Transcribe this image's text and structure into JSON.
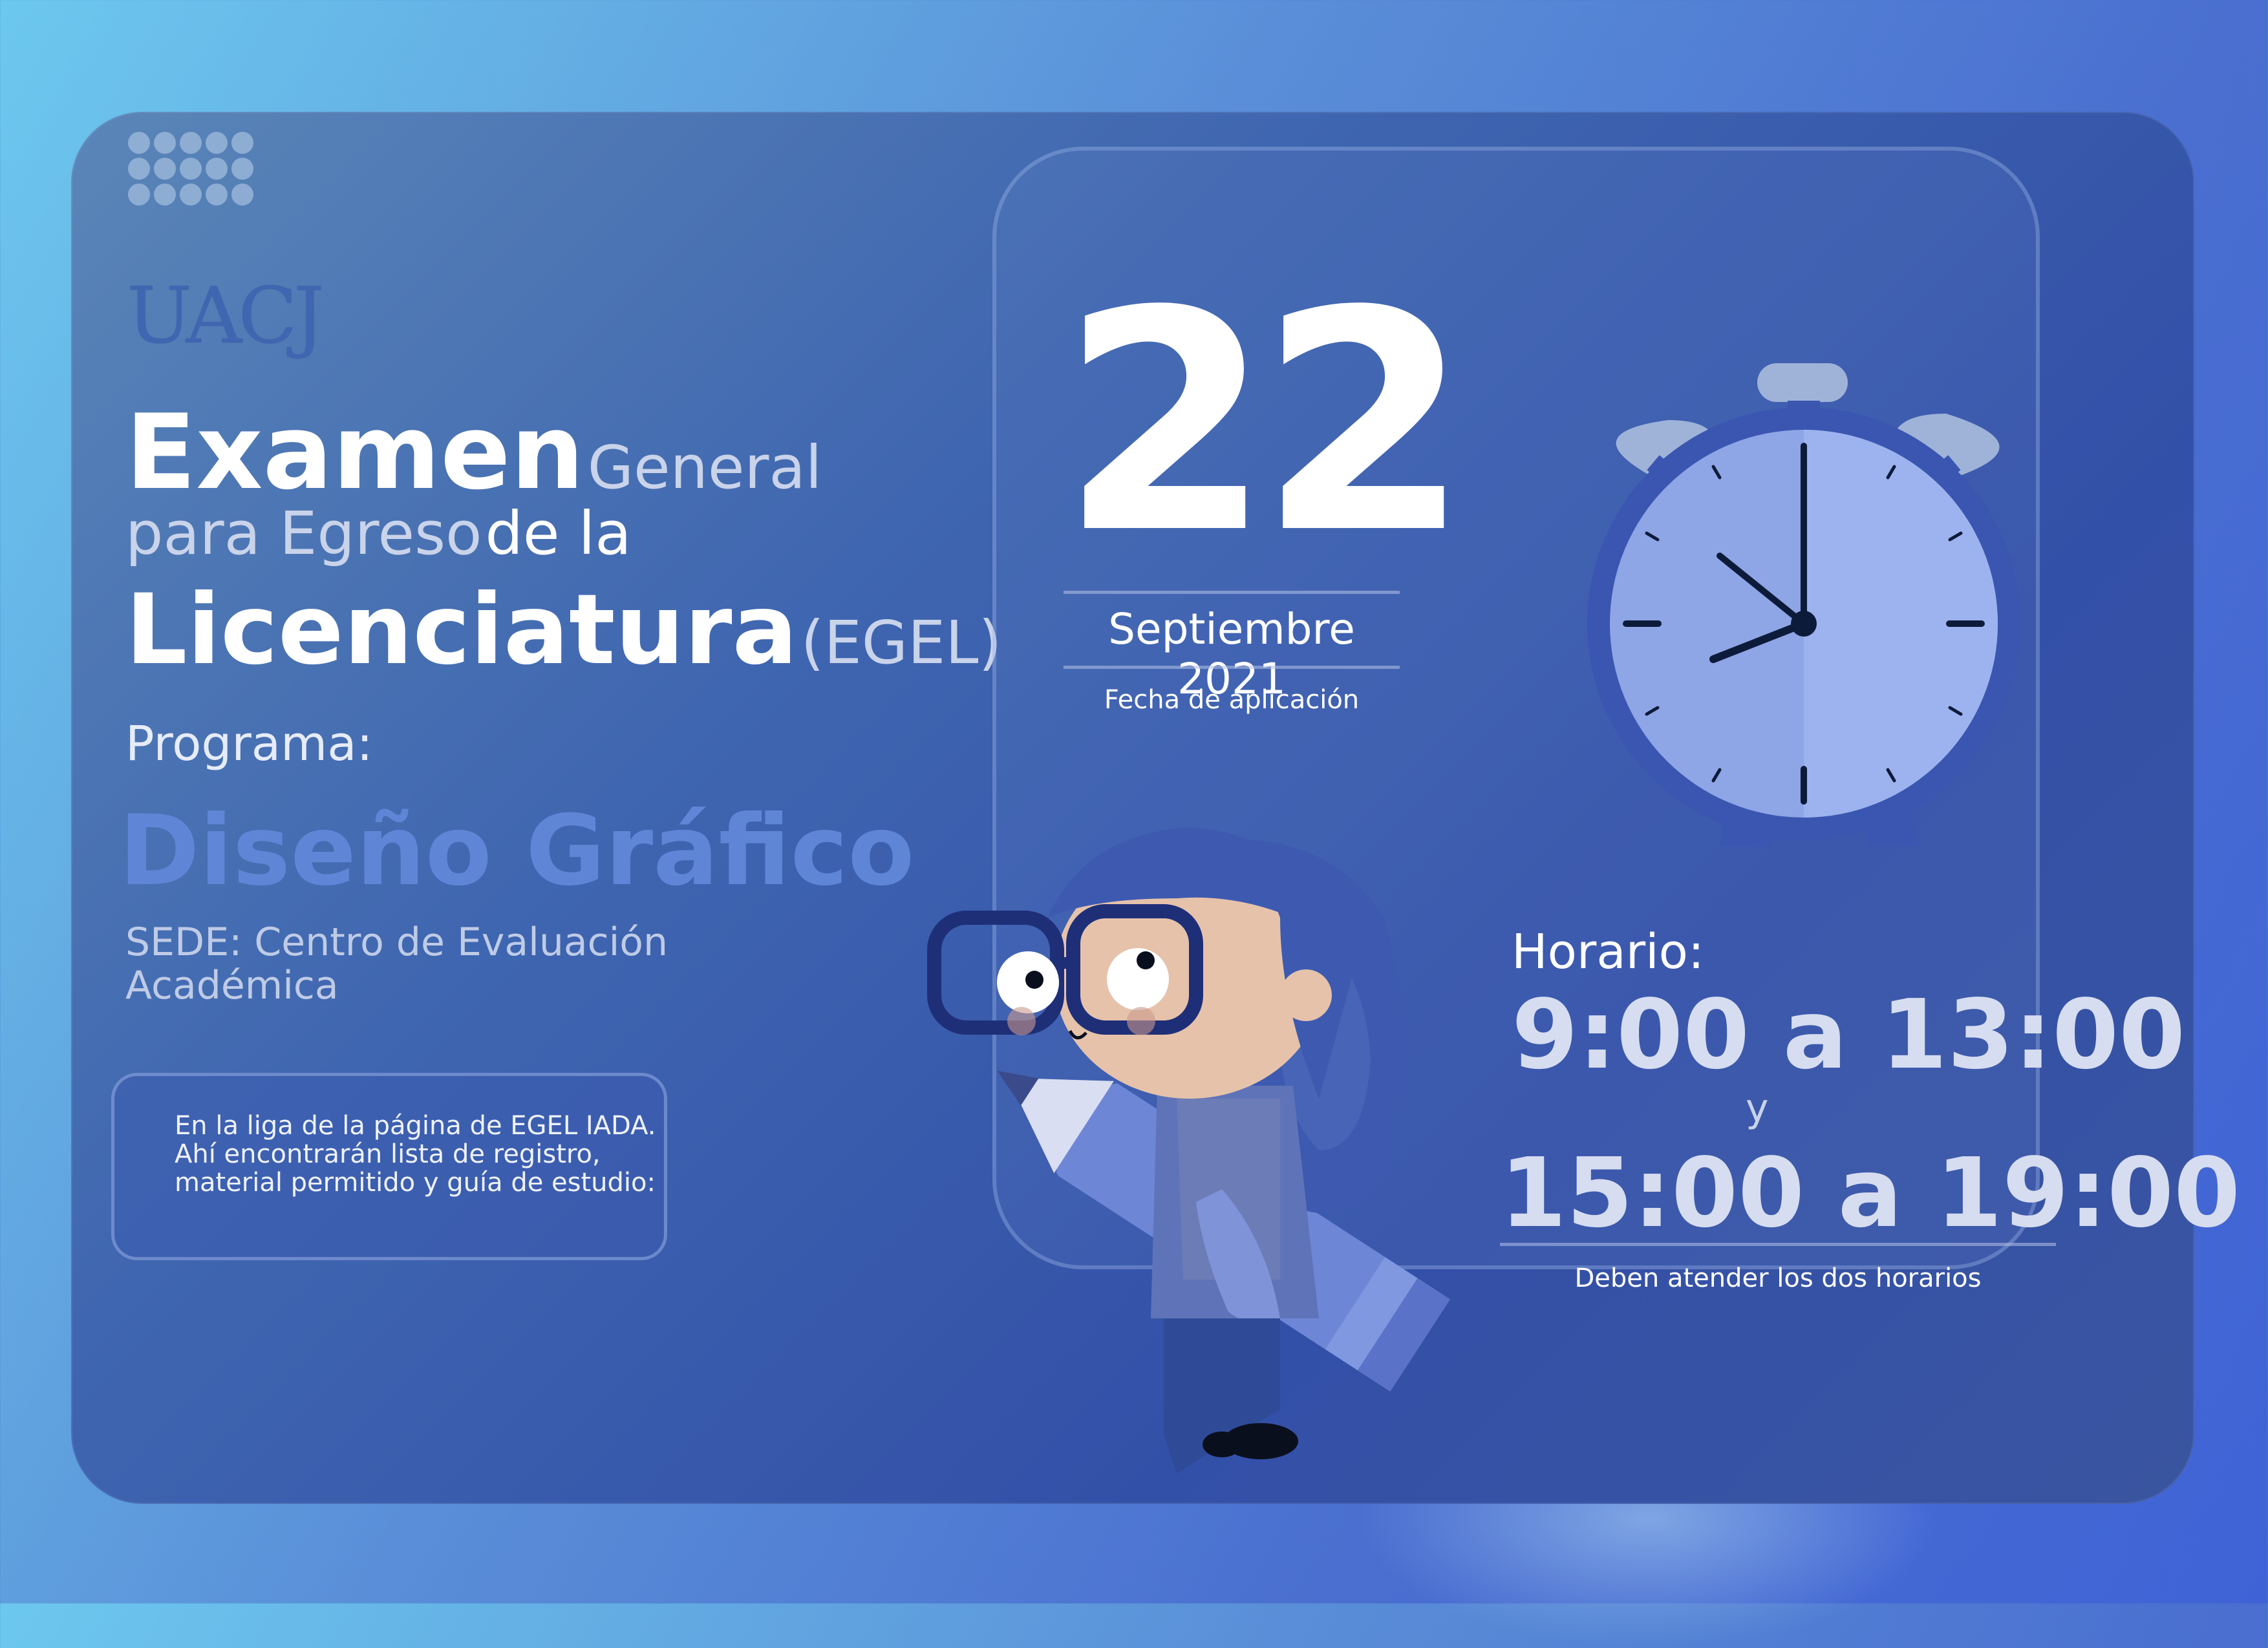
{
  "logo": {
    "text": "UACJ"
  },
  "title": {
    "word1": "Examen",
    "word2": "General",
    "line2_a": "para Egreso",
    "line2_b": "de la",
    "word3": "Licenciatura",
    "word4": "(EGEL)"
  },
  "program": {
    "label": "Programa:",
    "value": "Diseño Gráfico",
    "sede": "SEDE: Centro de Evaluación Académica"
  },
  "note": {
    "line1": "En la liga de la página de EGEL IADA.",
    "line2": "Ahí encontrarán lista de registro,",
    "line3": "material permitido y guía de estudio:"
  },
  "date": {
    "day": "22",
    "month_year": "Septiembre 2021",
    "caption": "Fecha de aplicación"
  },
  "schedule": {
    "label": "Horario:",
    "slot1": "9:00 a 13:00",
    "connector": "y",
    "slot2": "15:00 a 19:00",
    "caption": "Deben atender los dos horarios"
  },
  "colors": {
    "accent_program": "#5f86d6",
    "card_bg": "#3f66b0",
    "clock_face": "#93a8e8"
  },
  "icons": [
    "dot-grid-icon",
    "alarm-clock-icon",
    "student-with-pencil-illustration"
  ]
}
